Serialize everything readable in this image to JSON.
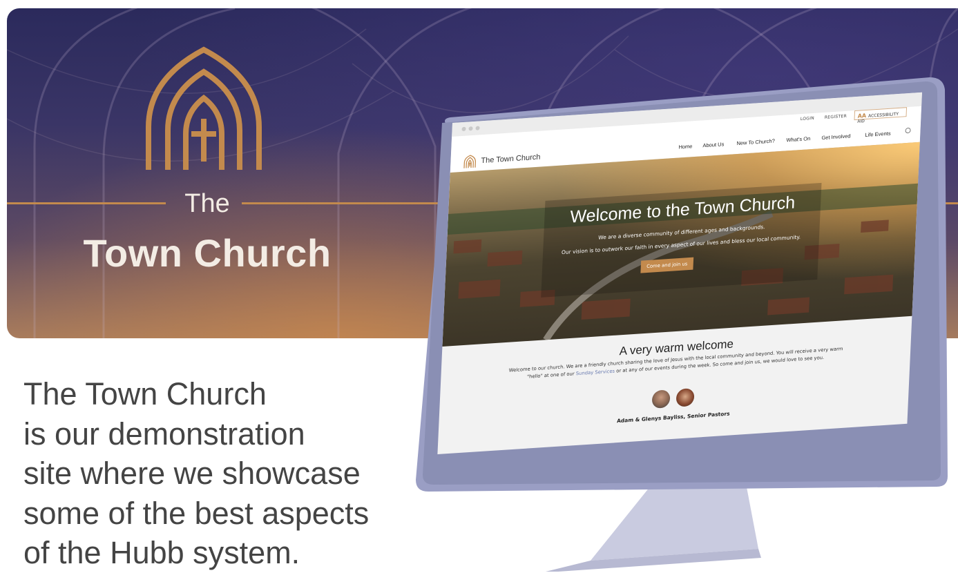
{
  "banner": {
    "the": "The",
    "name": "Town Church"
  },
  "description": {
    "lines": [
      "The Town Church",
      "is our demonstration",
      "site where we showcase",
      "some of the best aspects",
      "of the Hubb system."
    ]
  },
  "site": {
    "utility": {
      "login": "LOGIN",
      "register": "REGISTER",
      "accessibility_icon": "AA",
      "accessibility": "ACCESSIBILITY AID"
    },
    "name": "The Town Church",
    "nav": [
      "Home",
      "About Us",
      "New To Church?",
      "What's On",
      "Get Involved",
      "Life Events"
    ],
    "hero": {
      "title": "Welcome to the Town Church",
      "line1": "We are a diverse community of different ages and backgrounds.",
      "line2": "Our vision is to outwork our faith in every aspect of our lives and bless our local community.",
      "cta": "Come and join us"
    },
    "welcome": {
      "title": "A very warm welcome",
      "text_a": "Welcome to our church. We are a friendly church sharing the love of Jesus with the local community and beyond. You will receive a very warm \"hello\" at one of our ",
      "link": "Sunday Services",
      "text_b": " or at any of our events during the week. So come and join us, we would love to see you.",
      "pastors": "Adam & Glenys Bayliss, Senior Pastors"
    }
  },
  "colors": {
    "accent": "#c38a4d",
    "text": "#444444",
    "monitor": "#8a8fb4"
  }
}
